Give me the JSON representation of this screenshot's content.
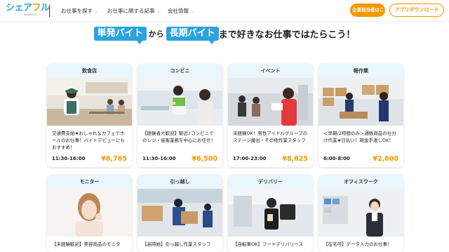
{
  "header": {
    "logo_main_left": "シェア",
    "logo_main_accent": "フ",
    "logo_main_right": "ル",
    "logo_sub": "by DENTSU",
    "nav": [
      "お仕事を探す",
      "お仕事に関する記事",
      "会社情報"
    ],
    "btn_company": "企業担当者はこちら",
    "btn_app": "アプリダウンロード"
  },
  "headline": {
    "tag1": "単発バイト",
    "mid": "から",
    "tag2": "長期バイト",
    "rest": "まで好きなお仕事ではたらこう！"
  },
  "cards": [
    {
      "category": "飲食店",
      "desc": "交通費支給★おしゃれなカフェでホールのお仕事！バイトデビューにもおすすめ！",
      "time": "11:30-16:00",
      "price": "¥6,765"
    },
    {
      "category": "コンビニ",
      "desc": "【経験者大歓迎】駅近♪コンビニでのレジ・接客業務を中心にお任せ！",
      "time": "11:30-16:00",
      "price": "¥6,500"
    },
    {
      "category": "イベント",
      "desc": "未経験OK！男性アイドルグループのステージ搬出・その他作業スタッフ",
      "time": "17:00-23:00",
      "price": "¥8,625"
    },
    {
      "category": "軽作業",
      "desc": "＜早朝/2時間のみ＞通販商品の仕分け作業★日払い！現金手渡しOK！",
      "time": "6:00-8:00",
      "price": "¥2,600"
    },
    {
      "category": "モニター",
      "desc": "【未経験歓迎】美容商品のモニタ",
      "time": "",
      "price": ""
    },
    {
      "category": "引っ越し",
      "desc": "【高時給】引っ越し作業スタッフ",
      "time": "",
      "price": ""
    },
    {
      "category": "デリバリー",
      "desc": "【自転車OK】フードデリバリース",
      "time": "",
      "price": ""
    },
    {
      "category": "オフィスワーク",
      "desc": "【在宅可】データ入力のお仕事！",
      "time": "",
      "price": ""
    }
  ],
  "colors": {
    "brand_blue": "#2aa3de",
    "accent_orange": "#f39800",
    "card_bg": "#e9f6fc"
  }
}
